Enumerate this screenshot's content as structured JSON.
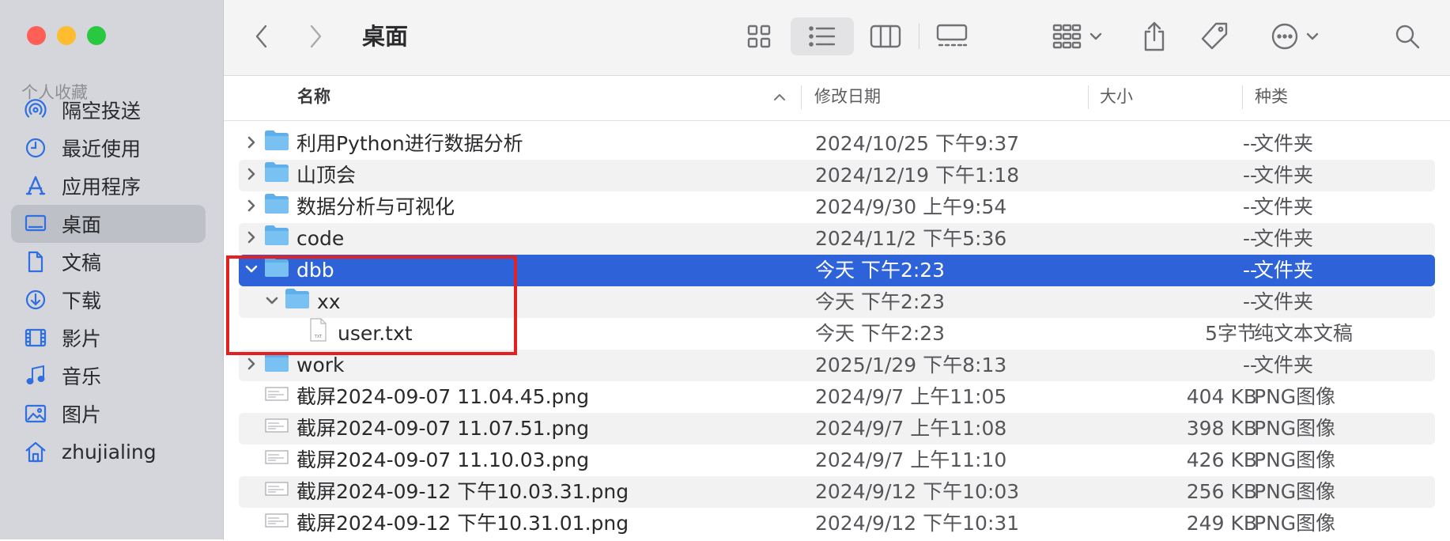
{
  "window": {
    "title": "桌面"
  },
  "sidebar": {
    "heading": "个人收藏",
    "items": [
      {
        "label": "隔空投送",
        "icon": "airdrop-icon"
      },
      {
        "label": "最近使用",
        "icon": "clock-icon"
      },
      {
        "label": "应用程序",
        "icon": "applications-icon"
      },
      {
        "label": "桌面",
        "icon": "desktop-icon",
        "active": true
      },
      {
        "label": "文稿",
        "icon": "document-icon"
      },
      {
        "label": "下载",
        "icon": "download-icon"
      },
      {
        "label": "影片",
        "icon": "film-icon"
      },
      {
        "label": "音乐",
        "icon": "music-icon"
      },
      {
        "label": "图片",
        "icon": "photo-icon"
      },
      {
        "label": "zhujialing",
        "icon": "home-icon"
      }
    ]
  },
  "columns": {
    "name": "名称",
    "date": "修改日期",
    "size": "大小",
    "kind": "种类"
  },
  "rows": [
    {
      "name": "利用Python进行数据分析",
      "date": "2024/10/25 下午9:37",
      "size": "--",
      "kind": "文件夹",
      "type": "folder",
      "indent": 0,
      "expanded": false
    },
    {
      "name": "山顶会",
      "date": "2024/12/19 下午1:18",
      "size": "--",
      "kind": "文件夹",
      "type": "folder",
      "indent": 0,
      "expanded": false
    },
    {
      "name": "数据分析与可视化",
      "date": "2024/9/30 上午9:54",
      "size": "--",
      "kind": "文件夹",
      "type": "folder",
      "indent": 0,
      "expanded": false
    },
    {
      "name": "code",
      "date": "2024/11/2 下午5:36",
      "size": "--",
      "kind": "文件夹",
      "type": "folder",
      "indent": 0,
      "expanded": false
    },
    {
      "name": "dbb",
      "date": "今天 下午2:23",
      "size": "--",
      "kind": "文件夹",
      "type": "folder",
      "indent": 0,
      "expanded": true,
      "selected": true
    },
    {
      "name": "xx",
      "date": "今天 下午2:23",
      "size": "--",
      "kind": "文件夹",
      "type": "folder",
      "indent": 1,
      "expanded": true
    },
    {
      "name": "user.txt",
      "date": "今天 下午2:23",
      "size": "5字节",
      "kind": "纯文本文稿",
      "type": "txt",
      "indent": 2,
      "icon_label": "TXT"
    },
    {
      "name": "work",
      "date": "2025/1/29 下午8:13",
      "size": "--",
      "kind": "文件夹",
      "type": "folder",
      "indent": 0,
      "expanded": false
    },
    {
      "name": "截屏2024-09-07 11.04.45.png",
      "date": "2024/9/7 上午11:05",
      "size": "404 KB",
      "kind": "PNG图像",
      "type": "image",
      "indent": 0
    },
    {
      "name": "截屏2024-09-07 11.07.51.png",
      "date": "2024/9/7 上午11:08",
      "size": "398 KB",
      "kind": "PNG图像",
      "type": "image",
      "indent": 0
    },
    {
      "name": "截屏2024-09-07 11.10.03.png",
      "date": "2024/9/7 上午11:10",
      "size": "426 KB",
      "kind": "PNG图像",
      "type": "image",
      "indent": 0
    },
    {
      "name": "截屏2024-09-12 下午10.03.31.png",
      "date": "2024/9/12 下午10:03",
      "size": "256 KB",
      "kind": "PNG图像",
      "type": "image",
      "indent": 0
    },
    {
      "name": "截屏2024-09-12 下午10.31.01.png",
      "date": "2024/9/12 下午10:31",
      "size": "249 KB",
      "kind": "PNG图像",
      "type": "image",
      "indent": 0
    }
  ],
  "colors": {
    "selection": "#2e62d9",
    "annotation_box": "#e52020",
    "folder": "#5fb0ea",
    "close": "#ff5f57",
    "minimize": "#febc2e",
    "zoom": "#28c840"
  }
}
